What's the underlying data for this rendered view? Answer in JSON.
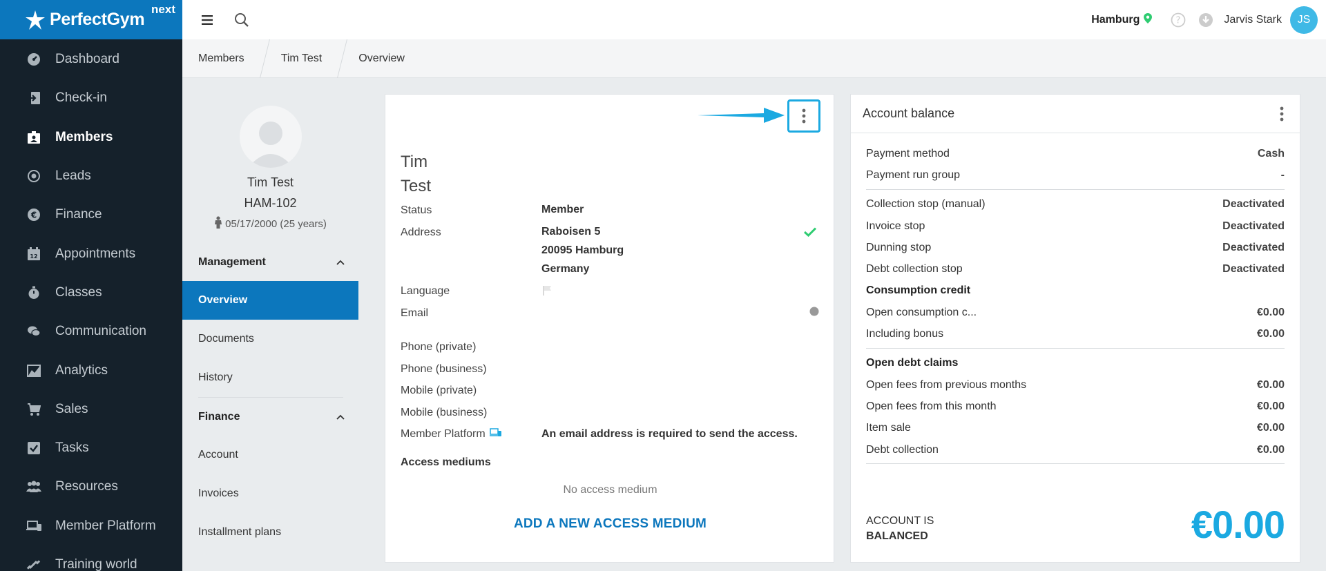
{
  "brand": {
    "name": "PerfectGym",
    "suffix": "next"
  },
  "nav": [
    {
      "label": "Dashboard",
      "icon": "dashboard-icon"
    },
    {
      "label": "Check-in",
      "icon": "check-in-icon"
    },
    {
      "label": "Members",
      "icon": "members-icon",
      "active": true
    },
    {
      "label": "Leads",
      "icon": "leads-icon"
    },
    {
      "label": "Finance",
      "icon": "finance-icon"
    },
    {
      "label": "Appointments",
      "icon": "calendar-icon"
    },
    {
      "label": "Classes",
      "icon": "stopwatch-icon"
    },
    {
      "label": "Communication",
      "icon": "chat-icon"
    },
    {
      "label": "Analytics",
      "icon": "chart-icon"
    },
    {
      "label": "Sales",
      "icon": "cart-icon"
    },
    {
      "label": "Tasks",
      "icon": "checkbox-icon"
    },
    {
      "label": "Resources",
      "icon": "people-icon"
    },
    {
      "label": "Member Platform",
      "icon": "devices-icon"
    },
    {
      "label": "Training world",
      "icon": "dumbbell-icon"
    }
  ],
  "topbar": {
    "location": "Hamburg",
    "user_name": "Jarvis Stark",
    "user_initials": "JS"
  },
  "breadcrumb": [
    "Members",
    "Tim Test",
    "Overview"
  ],
  "profile": {
    "name": "Tim Test",
    "id": "HAM-102",
    "dob": "05/17/2000 (25 years)"
  },
  "sections": [
    {
      "title": "Management",
      "items": [
        "Overview",
        "Documents",
        "History"
      ],
      "active": "Overview"
    },
    {
      "title": "Finance",
      "items": [
        "Account",
        "Invoices",
        "Installment plans"
      ]
    }
  ],
  "member": {
    "first_name": "Tim",
    "last_name": "Test",
    "labels": {
      "status": "Status",
      "address": "Address",
      "language": "Language",
      "email": "Email",
      "phone_private": "Phone (private)",
      "phone_business": "Phone (business)",
      "mobile_private": "Mobile (private)",
      "mobile_business": "Mobile (business)",
      "member_platform": "Member Platform"
    },
    "status": "Member",
    "address_line1": "Raboisen 5",
    "address_line2": "20095 Hamburg",
    "address_line3": "Germany",
    "member_platform_note": "An email address is required to send the access.",
    "access_title": "Access mediums",
    "no_access": "No access medium",
    "add_access": "ADD A NEW ACCESS MEDIUM"
  },
  "balance": {
    "title": "Account balance",
    "rows1": [
      {
        "label": "Payment method",
        "value": "Cash"
      },
      {
        "label": "Payment run group",
        "value": "-"
      }
    ],
    "rows2": [
      {
        "label": "Collection stop (manual)",
        "value": "Deactivated"
      },
      {
        "label": "Invoice stop",
        "value": "Deactivated"
      },
      {
        "label": "Dunning stop",
        "value": "Deactivated"
      },
      {
        "label": "Debt collection stop",
        "value": "Deactivated"
      }
    ],
    "consumption_title": "Consumption credit",
    "rows3": [
      {
        "label": "Open consumption c...",
        "value": "€0.00"
      },
      {
        "label": "Including bonus",
        "value": "€0.00"
      }
    ],
    "debt_title": "Open debt claims",
    "rows4": [
      {
        "label": "Open fees from previous months",
        "value": "€0.00"
      },
      {
        "label": "Open fees from this month",
        "value": "€0.00"
      },
      {
        "label": "Item sale",
        "value": "€0.00"
      },
      {
        "label": "Debt collection",
        "value": "€0.00"
      }
    ],
    "status_line1": "Account is",
    "status_line2": "balanced",
    "total": "€0.00"
  },
  "colors": {
    "primary": "#0c77bd",
    "accent": "#1ba9e1",
    "sidebar": "#15212b",
    "success": "#2ecc71"
  }
}
